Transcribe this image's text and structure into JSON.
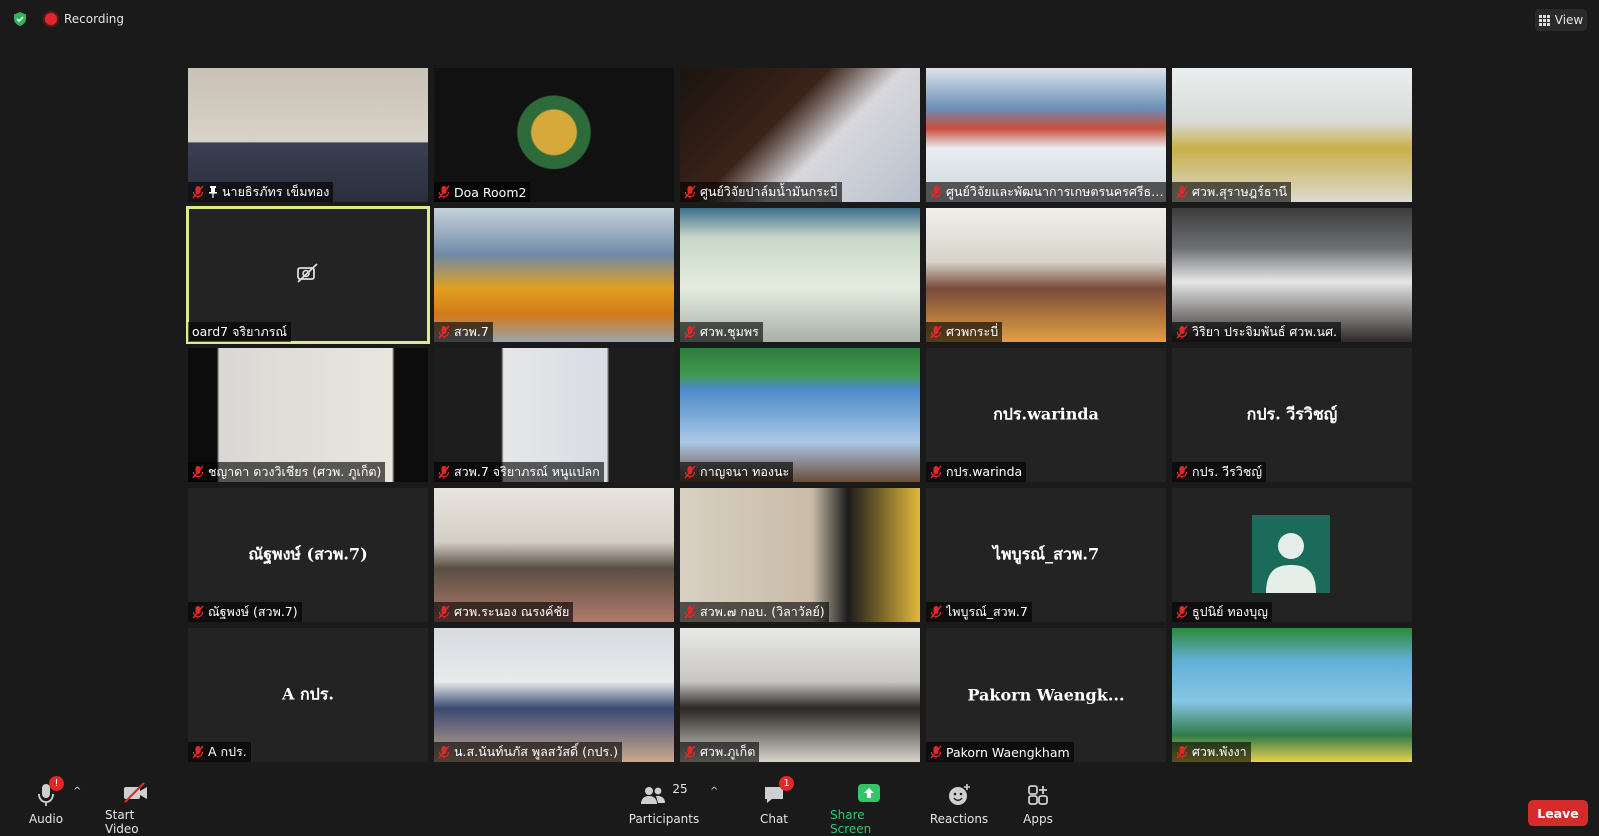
{
  "top_bar": {
    "recording_label": "Recording",
    "view_label": "View"
  },
  "tiles": [
    {
      "name": "นายธิรภัทร เข็มทอง",
      "pinned": true,
      "video": true
    },
    {
      "name": "Doa Room2",
      "video": true
    },
    {
      "name": "ศูนย์วิจัยปาล์มน้ำมันกระบี่",
      "video": true
    },
    {
      "name": "ศูนย์วิจัยและพัฒนาการเกษตรนครศรีธรร...",
      "video": true
    },
    {
      "name": "ศวพ.สุราษฎร์ธานี",
      "video": true
    },
    {
      "name": "oard7 จริยาภรณ์",
      "video": false,
      "active": true,
      "camera_off": true
    },
    {
      "name": "สวพ.7",
      "video": true
    },
    {
      "name": "ศวพ.ชุมพร",
      "video": true
    },
    {
      "name": "ศวพกระบี่",
      "video": true
    },
    {
      "name": "วิริยา ประจิมพันธ์ ศวพ.นศ.",
      "video": true
    },
    {
      "name": "ชญาดา ดวงวิเชียร (ศวพ. ภูเก็ต)",
      "video": true
    },
    {
      "name": "สวพ.7 จริยาภรณ์ หนูแปลก",
      "video": true
    },
    {
      "name": "กาญจนา ทองนะ",
      "video": true
    },
    {
      "name": "กปร.warinda",
      "video": false,
      "display_name": "กปร.warinda"
    },
    {
      "name": "กปร. วีรวิชญ์",
      "video": false,
      "display_name": "กปร. วีรวิชญ์"
    },
    {
      "name": "ณัฐพงษ์ (สวพ.7)",
      "video": false,
      "display_name": "ณัฐพงษ์ (สวพ.7)"
    },
    {
      "name": "ศวพ.ระนอง ณรงค์ชัย",
      "video": true
    },
    {
      "name": "สวพ.๗ กอบ. (วิลาวัลย์)",
      "video": true
    },
    {
      "name": "ไพบูรณ์_สวพ.7",
      "video": false,
      "display_name": "ไพบูรณ์_สวพ.7"
    },
    {
      "name": "ธูปนิย์ ทองบุญ",
      "video": false,
      "avatar": true
    },
    {
      "name": "A กปร.",
      "video": false,
      "display_name": "A กปร."
    },
    {
      "name": "น.ส.นันท์นภัส พูลสวัสดิ์ (กปร.)",
      "video": true
    },
    {
      "name": "ศวพ.ภูเก็ต",
      "video": true
    },
    {
      "name": "Pakorn Waengkham",
      "video": false,
      "display_name": "Pakorn  Waengk..."
    },
    {
      "name": "ศวพ.พังงา",
      "video": true
    }
  ],
  "toolbar": {
    "audio_label": "Audio",
    "audio_badge": "!",
    "video_label": "Start Video",
    "participants_label": "Participants",
    "participants_count": "25",
    "chat_label": "Chat",
    "chat_badge": "1",
    "share_label": "Share Screen",
    "reactions_label": "Reactions",
    "apps_label": "Apps",
    "leave_label": "Leave"
  },
  "colors": {
    "background": "#1a1a1a",
    "tile_bg": "#232323",
    "active_border": "#e0e890",
    "share_green": "#35c46a",
    "leave_red": "#d52b2b",
    "muted_mic_red": "#e02828"
  }
}
